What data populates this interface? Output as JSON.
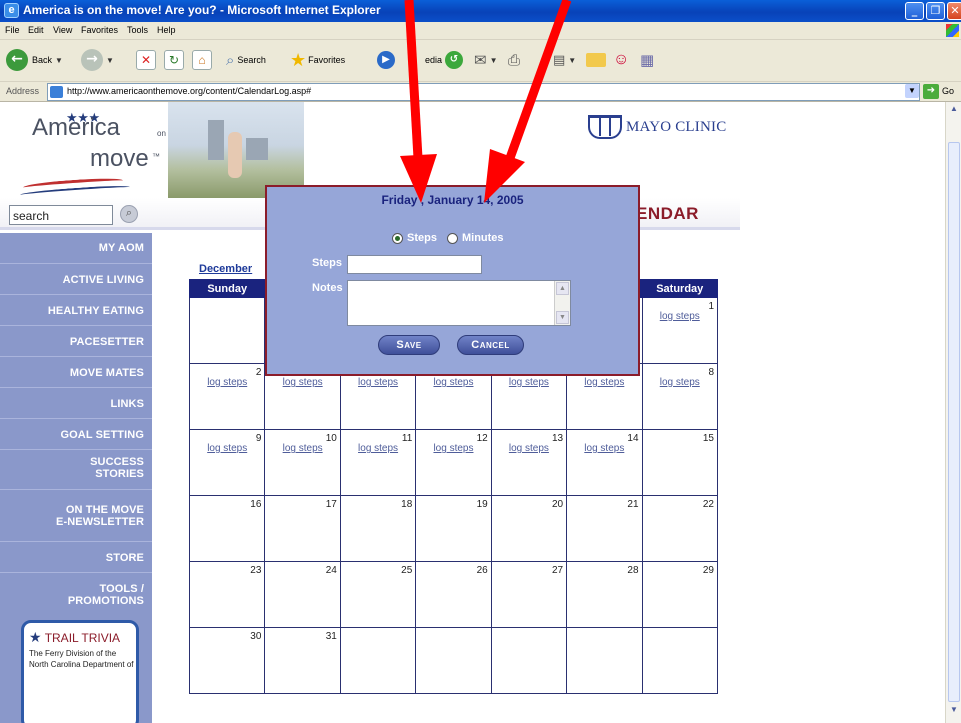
{
  "window": {
    "title": "America is on the move! Are you? - Microsoft Internet Explorer"
  },
  "menu": [
    "File",
    "Edit",
    "View",
    "Favorites",
    "Tools",
    "Help"
  ],
  "toolbar": {
    "back_label": "Back",
    "search_label": "Search",
    "favorites_label": "Favorites",
    "media_label": "edia"
  },
  "address": {
    "label": "Address",
    "url": "http://www.americaonthemove.org/content/CalendarLog.asp#",
    "go_label": "Go"
  },
  "header": {
    "logo_line1": "America",
    "logo_sub1": "on the",
    "logo_line2": "move",
    "logo_tm": "™",
    "mayo": "MAYO CLINIC",
    "search_value": "search",
    "page_title": "ENDAR"
  },
  "nav": {
    "items": [
      [
        "My AOM"
      ],
      [
        "Active Living"
      ],
      [
        "Healthy Eating"
      ],
      [
        "Pacesetter"
      ],
      [
        "Move Mates"
      ],
      [
        "Links"
      ],
      [
        "Goal Setting"
      ],
      [
        "Success",
        "Stories"
      ],
      [
        "On the Move",
        "E-Newsletter"
      ],
      [
        "Store"
      ],
      [
        "Tools /",
        "Promotions"
      ]
    ]
  },
  "trivia": {
    "title": "TRAIL TRIVIA",
    "body": "The Ferry Division of the North Carolina Department of"
  },
  "calendar": {
    "month_link": "December",
    "headers": [
      "Sunday",
      "",
      "",
      "",
      "",
      "",
      "Saturday"
    ],
    "log_label": "log steps",
    "weeks": [
      [
        {
          "n": "",
          "log": false
        },
        {
          "n": "",
          "log": false
        },
        {
          "n": "",
          "log": false
        },
        {
          "n": "",
          "log": false
        },
        {
          "n": "",
          "log": false
        },
        {
          "n": "",
          "log": false
        },
        {
          "n": "1",
          "log": true
        }
      ],
      [
        {
          "n": "2",
          "log": true
        },
        {
          "n": "3",
          "log": true
        },
        {
          "n": "4",
          "log": true
        },
        {
          "n": "5",
          "log": true
        },
        {
          "n": "6",
          "log": true
        },
        {
          "n": "7",
          "log": true
        },
        {
          "n": "8",
          "log": true
        }
      ],
      [
        {
          "n": "9",
          "log": true
        },
        {
          "n": "10",
          "log": true
        },
        {
          "n": "11",
          "log": true
        },
        {
          "n": "12",
          "log": true
        },
        {
          "n": "13",
          "log": true
        },
        {
          "n": "14",
          "log": true
        },
        {
          "n": "15",
          "log": false
        }
      ],
      [
        {
          "n": "16",
          "log": false
        },
        {
          "n": "17",
          "log": false
        },
        {
          "n": "18",
          "log": false
        },
        {
          "n": "19",
          "log": false
        },
        {
          "n": "20",
          "log": false
        },
        {
          "n": "21",
          "log": false
        },
        {
          "n": "22",
          "log": false
        }
      ],
      [
        {
          "n": "23",
          "log": false
        },
        {
          "n": "24",
          "log": false
        },
        {
          "n": "25",
          "log": false
        },
        {
          "n": "26",
          "log": false
        },
        {
          "n": "27",
          "log": false
        },
        {
          "n": "28",
          "log": false
        },
        {
          "n": "29",
          "log": false
        }
      ],
      [
        {
          "n": "30",
          "log": false
        },
        {
          "n": "31",
          "log": false
        },
        {
          "n": "",
          "log": false
        },
        {
          "n": "",
          "log": false
        },
        {
          "n": "",
          "log": false
        },
        {
          "n": "",
          "log": false
        },
        {
          "n": "",
          "log": false
        }
      ]
    ]
  },
  "modal": {
    "date": "Friday , January 14, 2005",
    "radio_steps": "Steps",
    "radio_minutes": "Minutes",
    "selected": "Steps",
    "steps_label": "Steps",
    "notes_label": "Notes",
    "steps_value": "",
    "notes_value": "",
    "save_label": "Save",
    "cancel_label": "Cancel"
  },
  "colors": {
    "nav_bg": "#8a98ca",
    "header_row": "#1a237e",
    "modal_bg": "#96a6d8",
    "modal_border": "#8b1c2a",
    "arrow": "#ff0000"
  }
}
